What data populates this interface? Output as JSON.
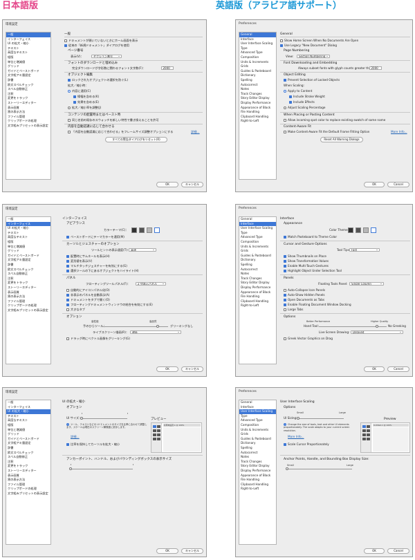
{
  "labels": {
    "jp": "日本語版",
    "en": "英語版（アラビア語サポート）"
  },
  "ui": {
    "jp": {
      "title": "環境設定",
      "ok": "OK",
      "cancel": "キャンセル",
      "sidebar": [
        "一般",
        "インターフェイス",
        "UI の拡大・縮小",
        "テキスト",
        "高度なテキスト",
        "組版",
        "単位と増減値",
        "グリッド",
        "ガイドとペーストボード",
        "文字組アキ量設定",
        "辞書",
        "欧文スペルチェック",
        "スペル自動修正",
        "注釈",
        "変更をトラック",
        "ストーリーエディター",
        "表示画質",
        "黒の表示方法",
        "ファイル管理",
        "クリップボードの処理",
        "文字組みプリセットの表示設定"
      ]
    },
    "en": {
      "title": "Preferences",
      "ok": "OK",
      "cancel": "Cancel",
      "sidebar": [
        "General",
        "Interface",
        "User Interface Scaling",
        "Type",
        "Advanced Type",
        "Composition",
        "Units & Increments",
        "Grids",
        "Guides & Pasteboard",
        "Dictionary",
        "Spelling",
        "Autocorrect",
        "Notes",
        "Track Changes",
        "Story Editor Display",
        "Display Performance",
        "Appearance of Black",
        "File Handling",
        "Clipboard Handling",
        "Right-to-Left"
      ]
    }
  },
  "jp_general": {
    "section": "一般",
    "cb1": "ドキュメントが開いていないときにホーム画面を表示",
    "cb2": "従来の「新規ドキュメント」ダイアログを使用",
    "page_num": "ページ番号",
    "view_label": "表示(V)：",
    "view_value": "セクション番号",
    "font_dl": "フォントのダウンロードと埋め込み",
    "font_line": "完全ダウンロードが字形数に関わるフォント文字数(F)：",
    "font_val": "2000",
    "obj_edit": "オブジェクト編集",
    "obj_cb": "ロックされたオブジェクトの選択を防ぐ(L)",
    "scaling": "拡大／縮小時：",
    "r1": "内容に適用(C)",
    "r1a": "線幅を含める(K)",
    "r1b": "効果を含める(E)",
    "r2": "拡大／縮小率を調整(J)",
    "paste": "コンテンツの配置時またはペースト時",
    "paste_cb": "同じ名前の既存のスウォッチを新しい特性で書き換えることを許可",
    "caf": "内容を自動認識に応じて合わせる",
    "caf_cb": "「内容を自動認識に応じて合わせる」をフレームサイズ調整オプションにする",
    "more": "詳細…",
    "reset": "すべての警告ダイアログをリセット(R)"
  },
  "en_general": {
    "section": "General",
    "cb1": "Show Home Screen When No Documents Are Open",
    "cb2": "Use Legacy \"New Document\" Dialog",
    "page_num": "Page Numbering",
    "view_label": "View:",
    "view_value": "Section Numbering",
    "font_dl": "Font Downloading and Embedding",
    "font_line": "Always subset fonts with glyph counts greater than:",
    "font_val": "2000",
    "obj_edit": "Object Editing",
    "obj_cb": "Prevent Selection of Locked Objects",
    "scaling": "When Scaling:",
    "r1": "Apply to Content",
    "r1a": "Include Stroke Weight",
    "r1b": "Include Effects",
    "r2": "Adjust Scaling Percentage",
    "paste": "When Placing or Pasting Content",
    "paste_cb": "Allow incoming spot color to replace existing swatch of same name",
    "caf": "Content-Aware Fit",
    "caf_cb": "Make Content-Aware Fit the Default Frame Fitting Option",
    "more": "More Info...",
    "reset": "Reset All Warning Dialogs"
  },
  "jp_interface": {
    "section": "インターフェイス",
    "appearance": "アピアランス",
    "color_theme": "カラーテーマ(C)：",
    "match_cb": "ペーストボードにテーマカラーを適用(M)",
    "cursor": "カーソルとジェスチャーのオプション",
    "tooltips": "ツールヒントの表示速度(T)：",
    "tooltips_val": "高速",
    "c1": "配置時にサムネールを表示(H)",
    "c2": "変形値を表示(V)",
    "c3": "マルチタッチジェスチャーを有効にする(G)",
    "c4": "選択ツールの下にあるオブジェクトをハイライト(H)",
    "panels": "パネル",
    "floating": "フローティングツールパネル(F)：",
    "floating_val": "2 列表示パネル",
    "p1": "自動的にアイコンパネル化(O)",
    "p2": "非表示のパネルを自動表示(A)",
    "p3": "ドキュメントをタブで開く(O)",
    "p4": "フローティングドキュメントウィンドウの結合を有効にする(E)",
    "p5": "大きなタブ",
    "options": "オプション",
    "better_perf": "高性能",
    "higher_quality": "高品質",
    "hand_tool": "手のひらツール：",
    "hand_right": "グリーキングなし",
    "live_screen": "ライブスクリーン描画(R)：",
    "live_val": "遅延",
    "greek_cb": "ドラッグ時にベクトル画像をグリーキング(G)"
  },
  "en_interface": {
    "section": "Interface",
    "appearance": "Appearance",
    "color_theme": "Color Theme:",
    "match_cb": "Match Pasteboard to Theme Color",
    "cursor": "Cursor and Gesture Options",
    "tooltips": "Tool Tips:",
    "tooltips_val": "Fast",
    "c1": "Show Thumbnails on Place",
    "c2": "Show Transformation Values",
    "c3": "Enable Multi-Touch Gestures",
    "c4": "Highlight Object Under Selection Tool",
    "panels": "Panels",
    "floating": "Floating Tools Panel:",
    "floating_val": "Single Column",
    "p1": "Auto-Collapse Icon Panels",
    "p2": "Auto-Show Hidden Panels",
    "p3": "Open Documents as Tabs",
    "p4": "Enable Floating Document Window Docking",
    "p5": "Large Tabs",
    "options": "Options",
    "better_perf": "Better Performance",
    "higher_quality": "Higher Quality",
    "hand_tool": "Hand Tool:",
    "hand_right": "No Greeking",
    "live_screen": "Live Screen Drawing:",
    "live_val": "Delayed",
    "greek_cb": "Greek Vector Graphics on Drag"
  },
  "jp_scaling": {
    "section": "UI の拡大・縮小",
    "options": "オプション",
    "ui_size": "UI サイズ：",
    "hint": "ツール、テキストなどの UI エレメントのサイズを比率に合わせて調整します。スケールは現在のスクリーン解像度に依存します。",
    "more": "詳細…",
    "preview": "プレビュー",
    "scale_cb": "比率を保持してカーソルを拡大・縮小",
    "anchor": "アンカーポイント、ハンドル、およびバウンディングボックスの表示サイズ",
    "tab": "名称未設定-1 @ 100%"
  },
  "en_scaling": {
    "section": "User Interface Scaling",
    "options": "Options",
    "small": "Small",
    "large": "Large",
    "ui_size": "UI Sizing:",
    "hint": "Change the size of tools, text and other UI elements proportionately. The scale adapts to your current screen resolution.",
    "more": "More Info...",
    "preview": "Preview",
    "scale_cb": "Scale Cursor Proportionately",
    "anchor": "Anchor Points, Handle, and Bounding Box Display Size:",
    "tab": "Untitled-1 @ 100%"
  }
}
